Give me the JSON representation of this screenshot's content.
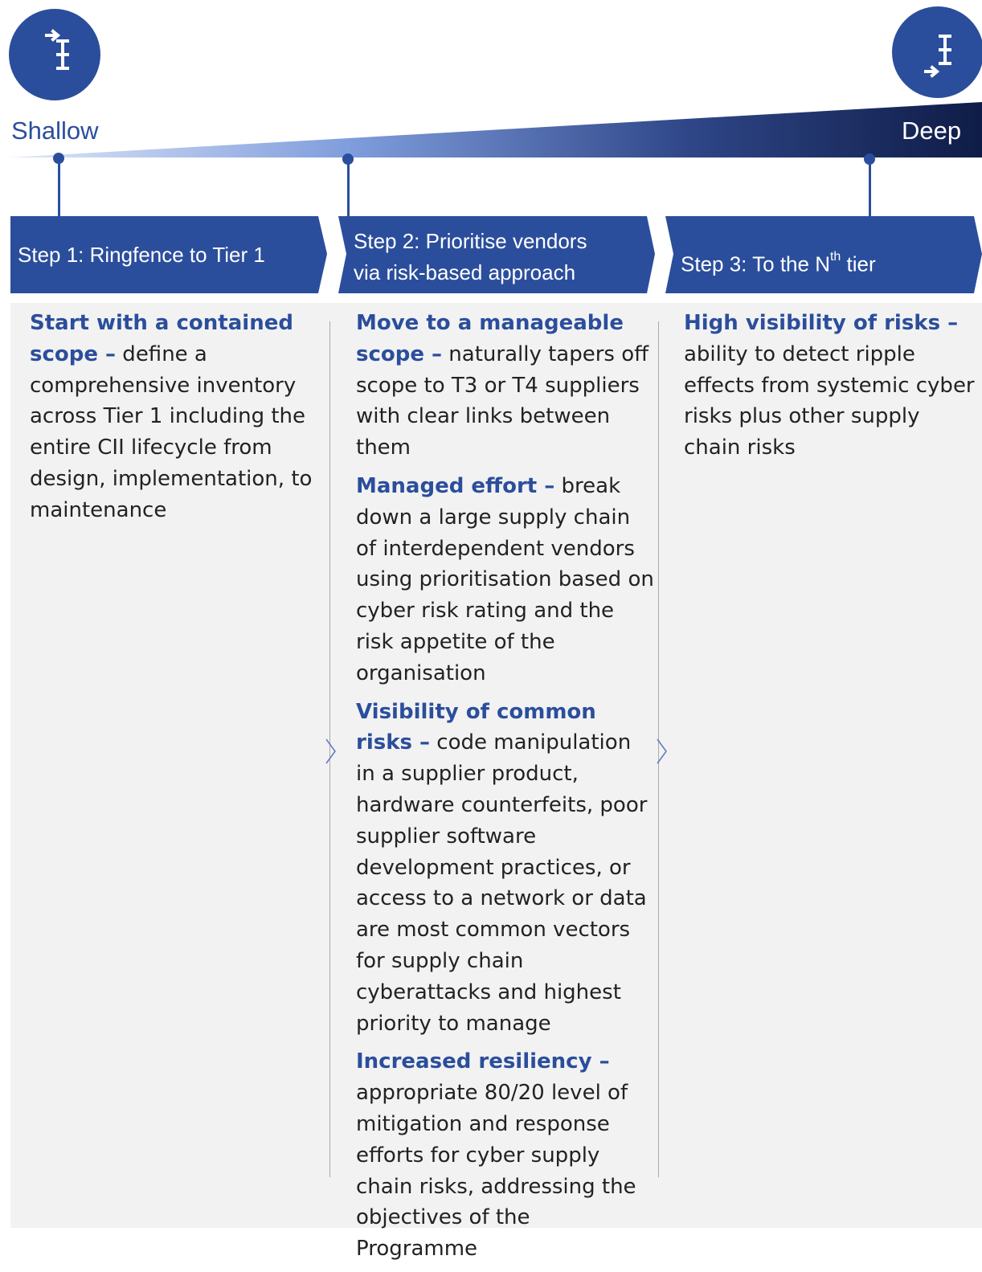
{
  "scale": {
    "start_label": "Shallow",
    "end_label": "Deep",
    "start_icon": "arrow-into-bracket-icon",
    "end_icon": "arrow-out-of-bracket-icon"
  },
  "colors": {
    "primary": "#2b4e9c",
    "dark": "#0f1c47",
    "light": "#c9d7f4",
    "panel": "#f2f2f2",
    "text": "#222222"
  },
  "steps": [
    {
      "label": "Step 1: Ringfence to Tier 1"
    },
    {
      "line1": "Step 2: Prioritise vendors",
      "line2": "via risk-based approach"
    },
    {
      "prefix": "Step 3: To the N",
      "sup": "th",
      "suffix": " tier"
    }
  ],
  "columns": [
    {
      "items": [
        {
          "title": "Start with a contained scope –",
          "text": " define a comprehensive inventory across Tier 1 including the entire CII lifecycle from design, implementation, to maintenance"
        }
      ]
    },
    {
      "items": [
        {
          "title": "Move to a manageable scope –",
          "text": " naturally tapers off scope to T3 or T4 suppliers with clear links between them"
        },
        {
          "title": "Managed effort –",
          "text": " break down a large supply chain of interdependent vendors using prioritisation based on cyber risk rating and the risk appetite of the organisation"
        },
        {
          "title": "Visibility of common risks –",
          "text": " code manipulation in a supplier product, hardware counterfeits, poor supplier software development practices, or access to a network or data are most common vectors for supply chain cyberattacks and highest priority to manage"
        },
        {
          "title": "Increased resiliency –",
          "text": " appropriate 80/20 level of mitigation and response efforts for cyber supply chain risks, addressing the objectives of the Programme"
        }
      ]
    },
    {
      "items": [
        {
          "title": "High visibility of risks –",
          "text": " ability to detect ripple effects from systemic cyber risks plus other supply chain risks"
        }
      ]
    }
  ]
}
